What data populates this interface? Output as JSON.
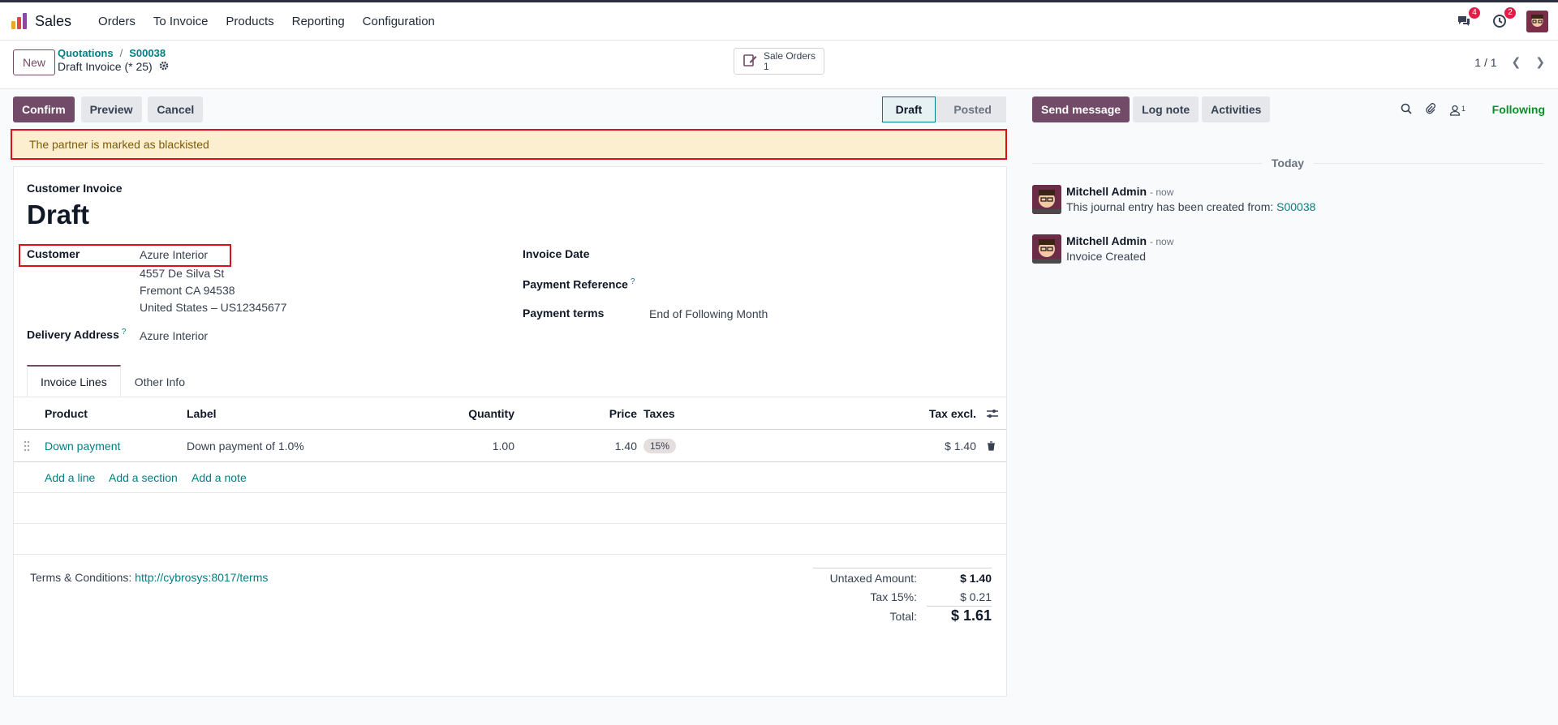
{
  "navbar": {
    "app_name": "Sales",
    "menu": [
      "Orders",
      "To Invoice",
      "Products",
      "Reporting",
      "Configuration"
    ],
    "messages_badge": "4",
    "activities_badge": "2",
    "logo_colors": [
      "#f4a522",
      "#e0483e",
      "#8a4b9e",
      "#1aa3a6"
    ]
  },
  "control_panel": {
    "new_label": "New",
    "breadcrumb": [
      "Quotations",
      "S00038"
    ],
    "record_title": "Draft Invoice (* 25)",
    "smart_button": {
      "label": "Sale Orders",
      "count": "1"
    },
    "pager": "1 / 1"
  },
  "actions": {
    "confirm": "Confirm",
    "preview": "Preview",
    "cancel": "Cancel"
  },
  "status": {
    "stages": [
      "Draft",
      "Posted"
    ],
    "current": "Draft"
  },
  "alert": "The partner is marked as blackisted",
  "invoice": {
    "type_label": "Customer Invoice",
    "title": "Draft",
    "customer_label": "Customer",
    "customer_name": "Azure Interior",
    "address_line1": "4557 De Silva St",
    "address_line2": "Fremont CA 94538",
    "address_line3": "United States – US12345677",
    "delivery_label": "Delivery Address",
    "delivery_value": "Azure Interior",
    "invoice_date_label": "Invoice Date",
    "payment_ref_label": "Payment Reference",
    "payment_terms_label": "Payment terms",
    "payment_terms_value": "End of Following Month",
    "help_mark": "?"
  },
  "tabs": [
    "Invoice Lines",
    "Other Info"
  ],
  "lines": {
    "headers": {
      "product": "Product",
      "label": "Label",
      "quantity": "Quantity",
      "price": "Price",
      "taxes": "Taxes",
      "tax_excl": "Tax excl."
    },
    "rows": [
      {
        "product": "Down payment",
        "label": "Down payment of 1.0%",
        "quantity": "1.00",
        "price": "1.40",
        "tax": "15%",
        "tax_excl": "$ 1.40"
      }
    ],
    "add_line": "Add a line",
    "add_section": "Add a section",
    "add_note": "Add a note"
  },
  "terms": {
    "label": "Terms & Conditions:",
    "link": "http://cybrosys:8017/terms"
  },
  "totals": {
    "untaxed_label": "Untaxed Amount:",
    "untaxed_value": "$ 1.40",
    "tax_label": "Tax 15%:",
    "tax_value": "$ 0.21",
    "total_label": "Total:",
    "total_value": "$ 1.61"
  },
  "chatter": {
    "send_message": "Send message",
    "log_note": "Log note",
    "activities": "Activities",
    "followers_count": "1",
    "following": "Following",
    "date_separator": "Today",
    "messages": [
      {
        "author": "Mitchell Admin",
        "time": "- now",
        "body": "This journal entry has been created from:",
        "link": "S00038"
      },
      {
        "author": "Mitchell Admin",
        "time": "- now",
        "body": "Invoice Created"
      }
    ]
  },
  "colors": {
    "brand": "#714B67",
    "link": "#017e84",
    "alert_bg": "#fcefcf",
    "highlight_border": "#e00d1b",
    "following": "#0c8f27"
  }
}
